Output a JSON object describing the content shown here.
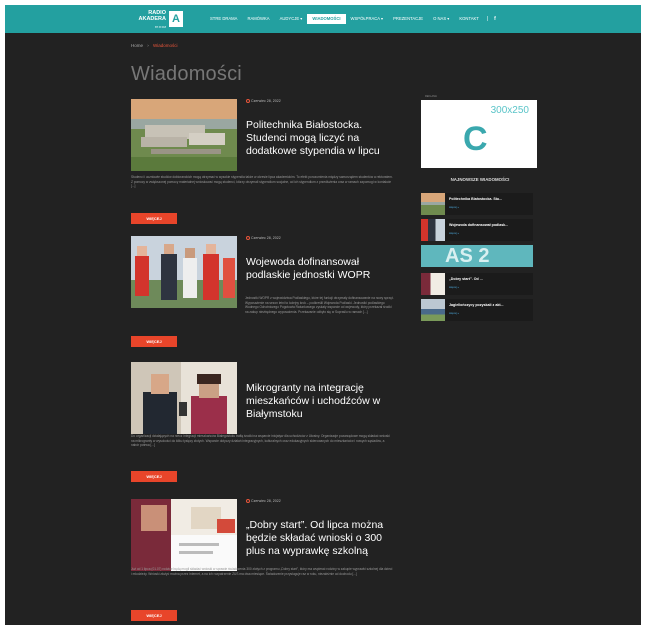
{
  "brand": {
    "name": "RADIO AKADERA",
    "sub": "87.8 FM",
    "mark": "A"
  },
  "nav": {
    "items": [
      "STRE DRAMA",
      "RAMÓWKA",
      "AUDYCJE ▾",
      "WIADOMOŚCI",
      "WSPÓŁPRACA ▾",
      "PREZENTACJE",
      "O NAS ▾",
      "KONTAKT"
    ],
    "active_index": 3,
    "separator": "|",
    "facebook": "f"
  },
  "breadcrumb": {
    "home": "Home",
    "sep": "›",
    "current": "Wiadomości"
  },
  "page_title": "Wiadomości",
  "articles": [
    {
      "date": "Czerwiec 28, 2022",
      "title": "Politechnika Białostocka. Studenci mogą liczyć na dodatkowe stypendia w lipcu",
      "excerpt": "Studenci i uczniowie studiów doktoranckich mogą otrzymać w wysokie stypendia także w okresie lipca akademickim. To efekt porozumienia między samorządem studentów a rektoratem. Z pomocy w zwiększonej pomocy materialnej wnioskować mogą studenci, którzy otrzymali stypendium socjalne, od ich stypendium z przedłużenia oraz w ramach zapomogi w kontakcie [...]",
      "readmore": "WIĘCEJ"
    },
    {
      "date": "Czerwiec 28, 2022",
      "title": "Wojewoda dofinansował podlaskie jednostki WOPR",
      "excerpt": "Jednostki WOPR z województwa Podlaskiego, które tej funkcji otrzymały dofinansowanie na nowy sprzęt. Wyposażenie na sezon letni to kolejny krok – podkreślił Wojewoda Podlaski. Jednostki podlaskiego Wodnego Ochotniczego Pogotowia Ratunkowego zyskały wsparcie od wojewody, który przekazał środki na zakup niezbędnego wyposażenia. Przekazanie odbyło się w Supraślu w ramach [...]",
      "readmore": "WIĘCEJ"
    },
    {
      "date": "Czerwiec 28, 2022",
      "title": "Mikrogranty na integrację mieszkańców i uchodźców w Białymstoku",
      "excerpt": "Do organizacji działających na rzecz integracji mieszkańców Białegostoku trafią środki na wsparcie inicjatyw dla uchodźców z Ukrainy. Organizacje pozarządowe mogą składać wnioski na mikrogranty w wysokości do kilku tysięcy złotych. Wsparcie dotyczy działań integracyjnych, kulturalnych oraz edukacyjnych skierowanych do mieszkańców i nowych sąsiadów, a nabór potrwa [...]",
      "readmore": "WIĘCEJ"
    },
    {
      "date": "Czerwiec 28, 2022",
      "title": "„Dobry start”. Od lipca można będzie składać wnioski o 300 plus na wyprawkę szkolną",
      "excerpt": "Już od 1 lipca (01.07) rodzice będą mogli składać wnioski w sprawie świadczenia 300 złotych z programu „Dobry start”, który ma wspierać rodziny w zakupie wyprawki szkolnej dla dzieci i młodzieży. Wnioski złożyć można przez internet, a na ich rozpatrzenie ZUS ma dwa miesiące. Świadczenie przysługuje raz w roku, niezależnie od dochodu [...]",
      "readmore": "WIĘCEJ"
    }
  ],
  "sidebar": {
    "ad_label": "REKLAMA",
    "ad_size": "300x250",
    "ad_mark": "C",
    "latest_heading": "NAJNOWSZE WIADOMOŚCI",
    "latest": [
      {
        "title": "Politechnika Białostocka. Stu...",
        "more": "więcej »"
      },
      {
        "title": "Wojewoda dofinansował podlask...",
        "more": "więcej »"
      },
      {
        "title": "„Dobry start”. Od ...",
        "more": "więcej »"
      },
      {
        "title": "Jagiellończycy pozyskali z akt...",
        "more": "więcej »"
      }
    ],
    "banner_text": "AS 2"
  },
  "colors": {
    "teal": "#23a0a0",
    "accent": "#e8452a",
    "bg": "#222222"
  }
}
